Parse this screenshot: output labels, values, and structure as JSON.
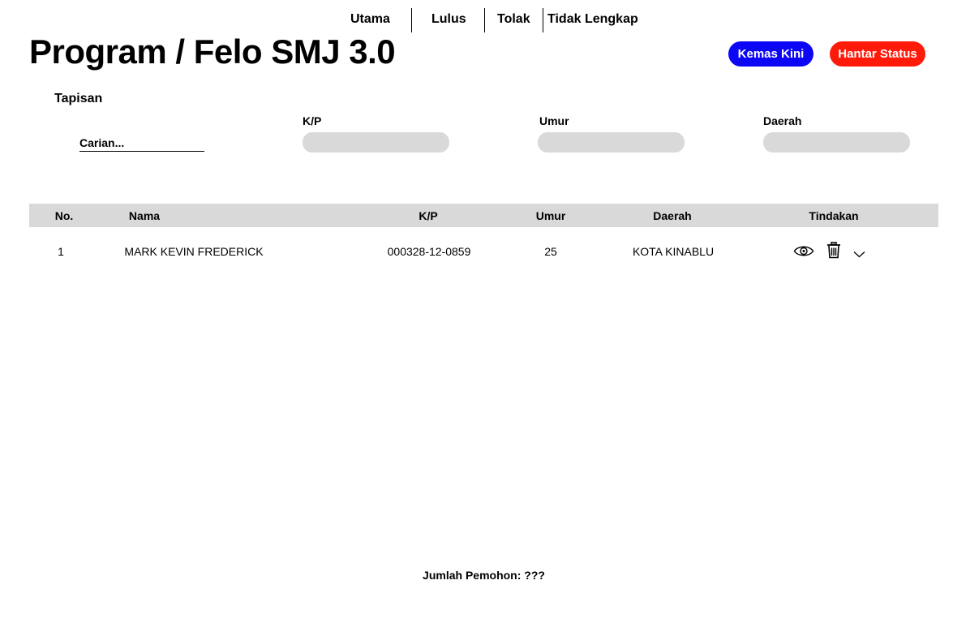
{
  "nav": {
    "items": [
      {
        "label": "Utama"
      },
      {
        "label": "Lulus"
      },
      {
        "label": "Tolak"
      },
      {
        "label": "Tidak Lengkap"
      }
    ]
  },
  "header": {
    "title": "Program / Felo SMJ 3.0",
    "update_label": "Kemas Kini",
    "send_status_label": "Hantar Status"
  },
  "colors": {
    "update_button": "#0b06f5",
    "send_status_button": "#ff1a0a",
    "filter_box": "#d9d9d9",
    "table_header": "#d9d9d9"
  },
  "filters": {
    "heading": "Tapisan",
    "search_placeholder": "Carian...",
    "fields": [
      {
        "label": "K/P",
        "value": ""
      },
      {
        "label": "Umur",
        "value": ""
      },
      {
        "label": "Daerah",
        "value": ""
      }
    ]
  },
  "table": {
    "columns": [
      "No.",
      "Nama",
      "K/P",
      "Umur",
      "Daerah",
      "Tindakan"
    ],
    "rows": [
      {
        "no": "1",
        "nama": "MARK KEVIN FREDERICK",
        "kp": "000328-12-0859",
        "umur": "25",
        "daerah": "KOTA KINABLU",
        "actions": [
          "eye-icon",
          "trash-icon",
          "chevron-down-icon"
        ]
      }
    ]
  },
  "footer": {
    "count_text": "Jumlah Pemohon: ???"
  }
}
